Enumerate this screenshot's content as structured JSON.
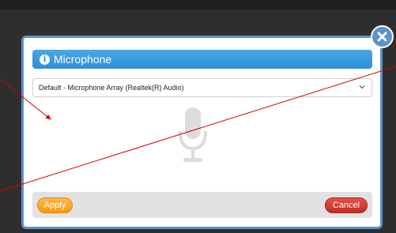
{
  "dialog": {
    "title": "Microphone",
    "device_select": {
      "value": "Default - Microphone Array (Realtek(R) Audio)"
    },
    "apply_label": "Apply",
    "cancel_label": "Cancel",
    "icons": {
      "info": "info-icon",
      "microphone": "microphone-icon",
      "close": "close-icon",
      "chevron": "chevron-down-icon"
    }
  },
  "colors": {
    "header": "#2d8fd8",
    "dialog_border": "#5b93c9",
    "apply": "#f59a14",
    "cancel": "#c02c23",
    "annotation": "#d40000"
  }
}
